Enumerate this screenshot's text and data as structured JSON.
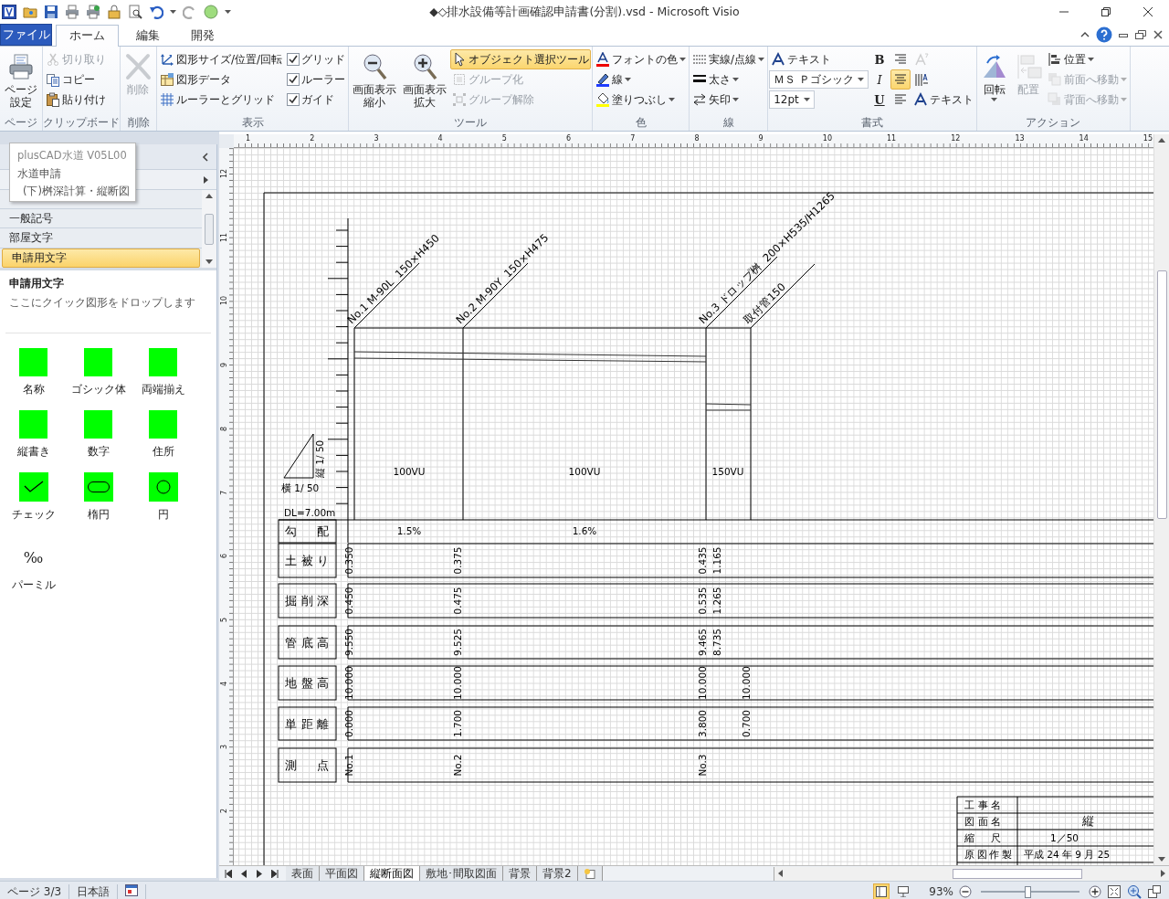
{
  "window": {
    "title": "◆◇排水設備等計画確認申請書(分割).vsd - Microsoft Visio"
  },
  "file_tab": "ファイル",
  "tabs": [
    {
      "label": "ホーム",
      "selected": true
    },
    {
      "label": "編集",
      "selected": false
    },
    {
      "label": "開発",
      "selected": false
    }
  ],
  "ribbon": [
    {
      "label": "ページ",
      "columns": [
        [
          {
            "kind": "large",
            "label": "ページ設定",
            "disabled": false,
            "active": false,
            "menu": false
          }
        ]
      ]
    },
    {
      "label": "クリップボード",
      "columns": [
        [
          {
            "kind": "small",
            "label": "切り取り",
            "disabled": true,
            "active": false,
            "menu": false
          },
          {
            "kind": "small",
            "label": "コピー",
            "disabled": false,
            "active": false,
            "menu": false
          },
          {
            "kind": "small",
            "label": "貼り付け",
            "disabled": false,
            "active": false,
            "menu": false
          }
        ]
      ]
    },
    {
      "label": "削除",
      "columns": [
        [
          {
            "kind": "large",
            "label": "削除",
            "disabled": true,
            "active": false,
            "menu": false
          }
        ]
      ]
    },
    {
      "label": "表示",
      "columns": [
        [
          {
            "kind": "small",
            "label": "図形サイズ/位置/回転",
            "disabled": false,
            "active": false,
            "menu": false
          },
          {
            "kind": "small",
            "label": "図形データ",
            "disabled": false,
            "active": false,
            "menu": false
          },
          {
            "kind": "small",
            "label": "ルーラーとグリッド",
            "disabled": false,
            "active": false,
            "menu": false
          }
        ],
        [
          {
            "kind": "check",
            "label": "グリッド",
            "checked": true
          },
          {
            "kind": "check",
            "label": "ルーラー",
            "checked": true
          },
          {
            "kind": "check",
            "label": "ガイド",
            "checked": true
          }
        ]
      ]
    },
    {
      "label": "ツール",
      "columns": [
        [
          {
            "kind": "large",
            "label": "画面表示縮小",
            "disabled": false,
            "active": false,
            "menu": false
          }
        ],
        [
          {
            "kind": "large",
            "label": "画面表示拡大",
            "disabled": false,
            "active": false,
            "menu": false
          }
        ],
        [
          {
            "kind": "small",
            "label": "オブジェクト選択ツール",
            "disabled": false,
            "active": true,
            "menu": false
          },
          {
            "kind": "small",
            "label": "グループ化",
            "disabled": true,
            "active": false,
            "menu": false
          },
          {
            "kind": "small",
            "label": "グループ解除",
            "disabled": true,
            "active": false,
            "menu": false
          }
        ]
      ]
    },
    {
      "label": "色",
      "columns": [
        [
          {
            "kind": "small",
            "label": "フォントの色",
            "disabled": false,
            "active": false,
            "menu": true
          },
          {
            "kind": "small",
            "label": "線",
            "disabled": false,
            "active": false,
            "menu": true
          },
          {
            "kind": "small",
            "label": "塗りつぶし",
            "disabled": false,
            "active": false,
            "menu": true
          }
        ]
      ]
    },
    {
      "label": "線",
      "columns": [
        [
          {
            "kind": "small",
            "label": "実線/点線",
            "disabled": false,
            "active": false,
            "menu": true
          },
          {
            "kind": "small",
            "label": "太さ",
            "disabled": false,
            "active": false,
            "menu": true
          },
          {
            "kind": "small",
            "label": "矢印",
            "disabled": false,
            "active": false,
            "menu": true
          }
        ]
      ]
    },
    {
      "label": "書式",
      "columns": [
        [
          {
            "kind": "small",
            "label": "テキスト",
            "disabled": false,
            "active": false,
            "menu": false
          },
          {
            "kind": "combo",
            "value": "ＭＳ Ｐゴシック"
          },
          {
            "kind": "combo",
            "value": "12pt"
          }
        ],
        [
          {
            "kind": "glyph",
            "label": "B",
            "disabled": false,
            "active": false
          },
          {
            "kind": "glyph",
            "label": "I",
            "disabled": false,
            "active": false
          },
          {
            "kind": "glyph",
            "label": "U",
            "disabled": false,
            "active": false
          }
        ],
        [
          {
            "kind": "icon",
            "disabled": false,
            "active": false
          },
          {
            "kind": "icon",
            "disabled": false,
            "active": true
          },
          {
            "kind": "icon",
            "disabled": false,
            "active": false
          }
        ],
        [
          {
            "kind": "icon",
            "disabled": true,
            "active": false
          },
          {
            "kind": "icon",
            "disabled": false,
            "active": false
          },
          {
            "kind": "small",
            "label": "テキスト",
            "disabled": false,
            "active": false,
            "menu": false
          }
        ]
      ]
    },
    {
      "label": "アクション",
      "columns": [
        [
          {
            "kind": "large",
            "label": "回転",
            "disabled": false,
            "active": false,
            "menu": true
          }
        ],
        [
          {
            "kind": "large",
            "label": "配置",
            "disabled": true,
            "active": false,
            "menu": false
          }
        ],
        [
          {
            "kind": "small",
            "label": "位置",
            "disabled": false,
            "active": false,
            "menu": true
          },
          {
            "kind": "small",
            "label": "前面へ移動",
            "disabled": true,
            "active": false,
            "menu": true
          },
          {
            "kind": "small",
            "label": "背面へ移動",
            "disabled": true,
            "active": false,
            "menu": true
          }
        ]
      ]
    }
  ],
  "sidebar": {
    "popup": {
      "header": "plusCAD水道  V05L00",
      "items": [
        {
          "label": "水道申請",
          "children": [
            {
              "label": "(下)桝深計算・縦断図"
            }
          ]
        }
      ]
    },
    "stencils": [
      {
        "label": "一般記号",
        "selected": false
      },
      {
        "label": "部屋文字",
        "selected": false
      },
      {
        "label": "申請用文字",
        "selected": true
      }
    ],
    "quick_shapes": {
      "title": "申請用文字",
      "hint": "ここにクイック図形をドロップします",
      "shapes": [
        {
          "kind": "square",
          "label": "名称"
        },
        {
          "kind": "square",
          "label": "ゴシック体"
        },
        {
          "kind": "square",
          "label": "両端揃え"
        },
        {
          "kind": "square",
          "label": "縦書き"
        },
        {
          "kind": "square",
          "label": "数字"
        },
        {
          "kind": "square",
          "label": "住所"
        },
        {
          "kind": "check",
          "label": "チェック"
        },
        {
          "kind": "ellipse",
          "label": "楕円"
        },
        {
          "kind": "circle",
          "label": "円"
        },
        {
          "kind": "symbol",
          "symbol": "‰",
          "label": "パーミル"
        }
      ]
    }
  },
  "rulers": {
    "horizontal": [
      "1",
      "2",
      "3",
      "4",
      "5",
      "6",
      "7",
      "8",
      "9",
      "10",
      "11",
      "12",
      "13",
      "14",
      "15"
    ],
    "vertical": [
      "12",
      "11",
      "10",
      "9",
      "8",
      "7",
      "6",
      "5",
      "4",
      "3",
      "2"
    ]
  },
  "drawing": {
    "stations": [
      {
        "label": "No.1 M-90L  150×H450"
      },
      {
        "label": "No.2 M-90Y  150×H475"
      },
      {
        "label": "No.3 ドロップ桝  200×H535/H1265"
      },
      {
        "label": "取付管150"
      }
    ],
    "pipes": [
      "100VU",
      "100VU",
      "150VU"
    ],
    "vertical_scale": "縦 1/ 50",
    "horizontal_scale": "横 1/ 50",
    "datum": "DL=7.00m",
    "profile_rows": [
      {
        "kind": "gradient",
        "label": "勾配",
        "values": [
          "1.5%",
          "1.6%"
        ]
      },
      {
        "kind": "level",
        "label": "土被り",
        "values": [
          "0.350",
          "0.375",
          "0.435",
          "1.165"
        ]
      },
      {
        "kind": "level",
        "label": "掘削深",
        "values": [
          "0.450",
          "0.475",
          "0.535",
          "1.265"
        ]
      },
      {
        "kind": "level",
        "label": "管底高",
        "values": [
          "9.550",
          "9.525",
          "9.465",
          "8.735"
        ]
      },
      {
        "kind": "level",
        "label": "地盤高",
        "values": [
          "10.000",
          "10.000",
          "10.000",
          "10.000"
        ]
      },
      {
        "kind": "level",
        "label": "単距離",
        "values": [
          "0.000",
          "1.700",
          "3.800",
          "0.700"
        ]
      },
      {
        "kind": "level",
        "label": "測点",
        "values": [
          "No.1",
          "No.2",
          "No.3"
        ]
      }
    ],
    "title_block": [
      {
        "label": "工事名"
      },
      {
        "label": "図面名",
        "value": "縦"
      },
      {
        "label": "縮尺",
        "value": "1／50"
      },
      {
        "label": "原図作製",
        "value": "平成 24 年 9 月 25"
      }
    ]
  },
  "page_tabs": [
    {
      "label": "表面",
      "selected": false
    },
    {
      "label": "平面図",
      "selected": false
    },
    {
      "label": "縦断面図",
      "selected": true
    },
    {
      "label": "敷地･間取図面",
      "selected": false
    },
    {
      "label": "背景",
      "selected": false
    },
    {
      "label": "背景2",
      "selected": false
    }
  ],
  "status_bar": {
    "page": "ページ 3/3",
    "language": "日本語",
    "zoom": "93%",
    "zoom_slider": {
      "level": 0.47
    }
  }
}
